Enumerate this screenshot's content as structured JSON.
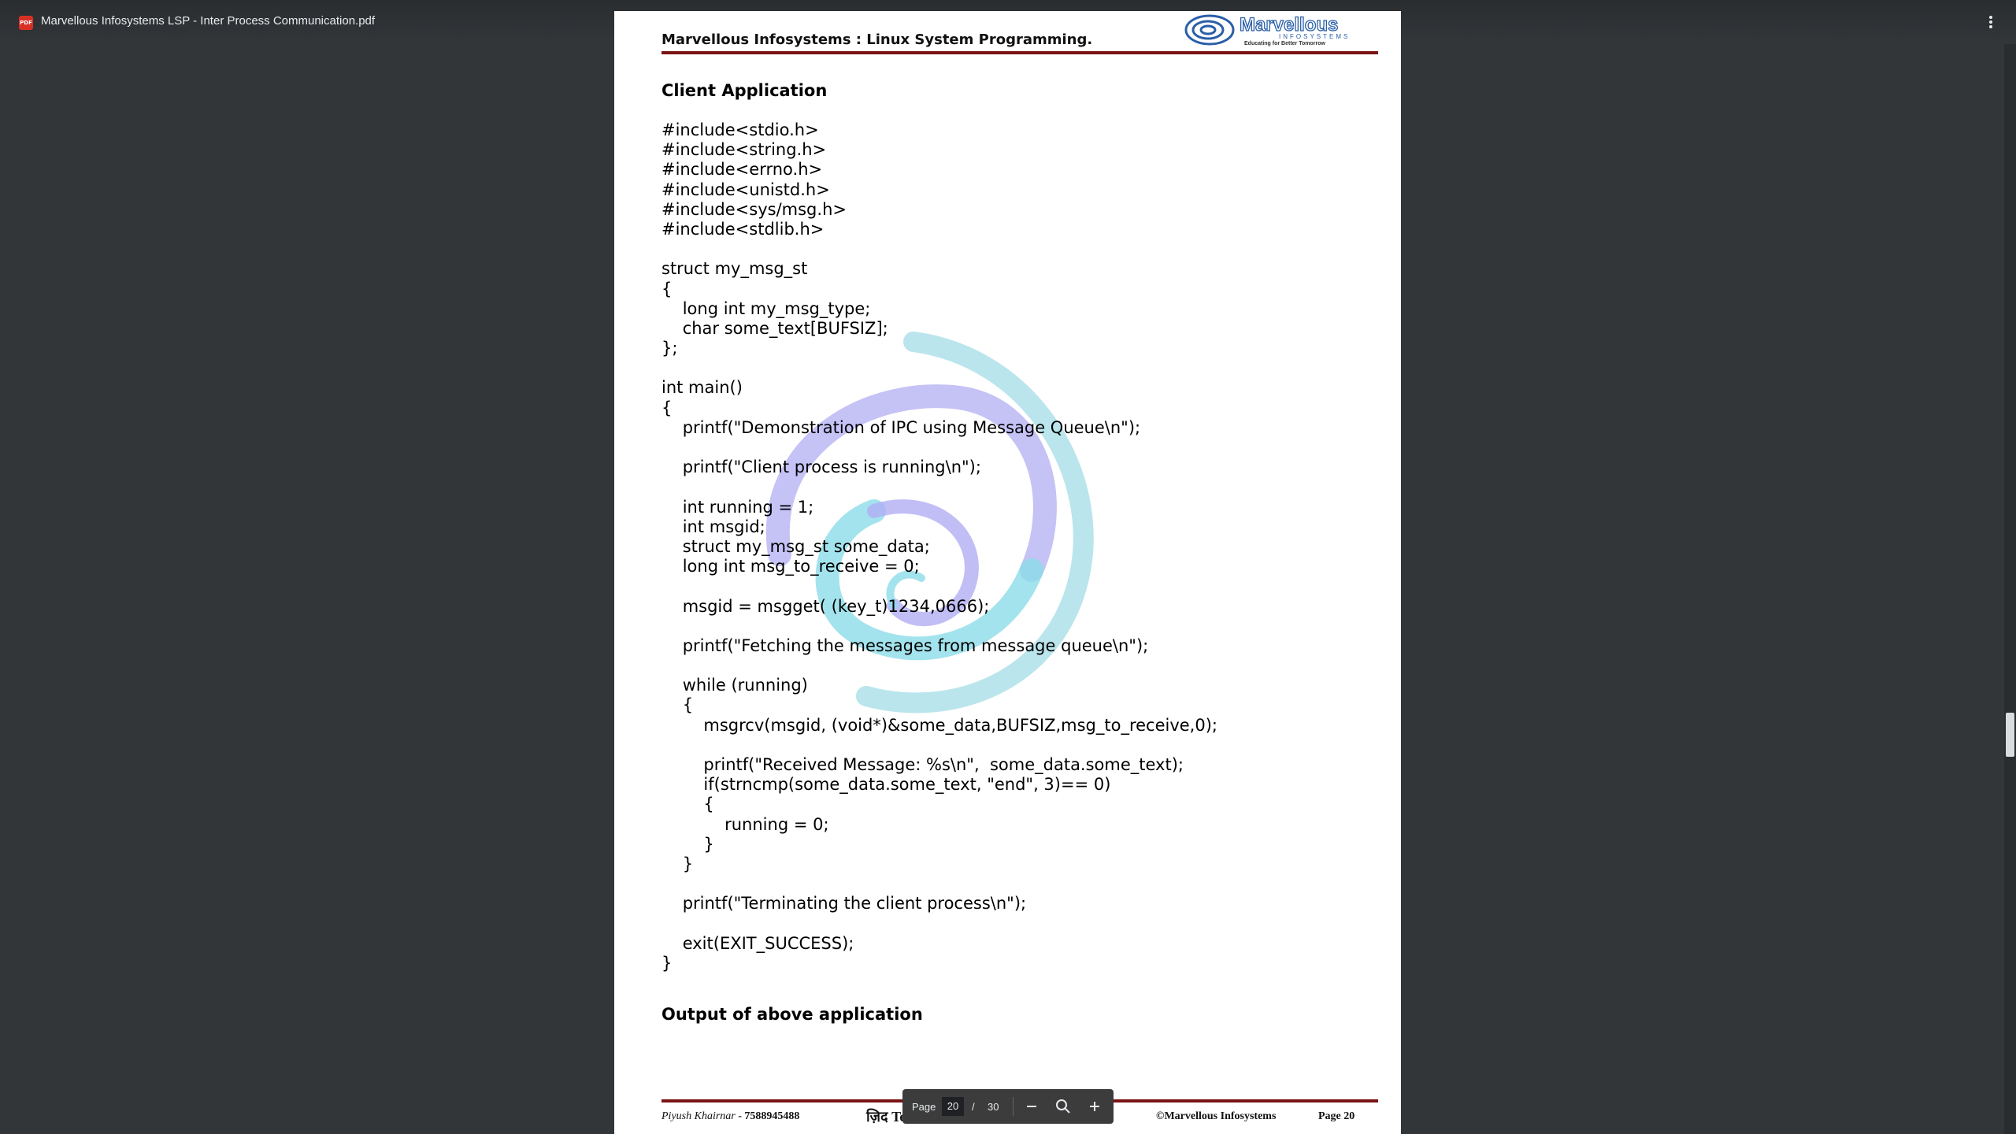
{
  "app": {
    "title": "Marvellous Infosystems LSP - Inter Process Communication.pdf",
    "icon": "pdf-icon",
    "badge": "PDF"
  },
  "page": {
    "header": "Marvellous Infosystems : Linux System Programming.",
    "logo": {
      "name": "Marvellous",
      "tag": "INFOSYSTEMS",
      "slogan": "Educating for Better Tomorrow"
    },
    "section_heading": "Client Application",
    "code_lines": [
      "#include<stdio.h>",
      "#include<string.h>",
      "#include<errno.h>",
      "#include<unistd.h>",
      "#include<sys/msg.h>",
      "#include<stdlib.h>",
      "",
      "struct my_msg_st",
      "{",
      "\tlong int my_msg_type;",
      "\tchar some_text[BUFSIZ];",
      "};",
      "",
      "int main()",
      "{",
      "\tprintf(\"Demonstration of IPC using Message Queue\\n\");",
      "",
      "\tprintf(\"Client process is running\\n\");",
      "",
      "\tint running = 1;",
      "\tint msgid;",
      "\tstruct my_msg_st some_data;",
      "\tlong int msg_to_receive = 0;",
      "",
      "\tmsgid = msgget( (key_t)1234,0666);",
      "",
      "\tprintf(\"Fetching the messages from message queue\\n\");",
      "",
      "\twhile (running)",
      "\t{",
      "\t\tmsgrcv(msgid, (void*)&some_data,BUFSIZ,msg_to_receive,0);",
      "",
      "\t\tprintf(\"Received Message: %s\\n\",  some_data.some_text);",
      "\t\tif(strncmp(some_data.some_text, \"end\", 3)== 0)",
      "\t\t{",
      "\t\t\trunning = 0;",
      "\t\t}",
      "\t}",
      "",
      "\tprintf(\"Terminating the client process\\n\");",
      "",
      "\texit(EXIT_SUCCESS);",
      "}"
    ],
    "output_heading": "Output of above application",
    "footer": {
      "author": "Piyush Khairnar",
      "phone": " - 7588945488",
      "middle": "ज़िद Technical शिक्षा देगी",
      "copyright": "©Marvellous Infosystems",
      "page_label": "Page 20"
    }
  },
  "toolbar": {
    "page_label": "Page",
    "current_page": "20",
    "separator": "/",
    "total_pages": "30",
    "zoom_out_icon": "minus-icon",
    "fit_icon": "zoom-fit-icon",
    "zoom_in_icon": "plus-icon"
  },
  "colors": {
    "viewer_bg": "#323639",
    "rule": "#7a1414",
    "logo_blue": "#2a5fa8",
    "watermark_purple": "#9e9bf0",
    "watermark_cyan": "#7fd8e6"
  }
}
